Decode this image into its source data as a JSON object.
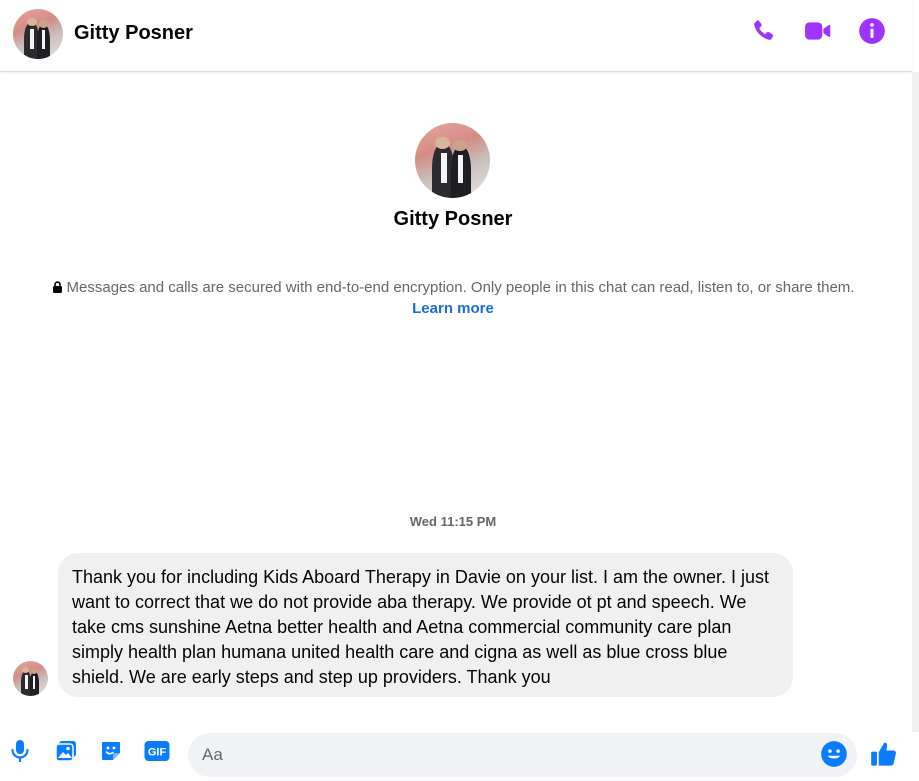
{
  "header": {
    "contact_name": "Gitty Posner",
    "icons": [
      "phone-icon",
      "video-camera-icon",
      "info-icon"
    ]
  },
  "profile": {
    "name": "Gitty Posner"
  },
  "encryption_notice": {
    "text": "Messages and calls are secured with end-to-end encryption. Only people in this chat can read, listen to, or share them.",
    "link": "Learn more"
  },
  "conversation": {
    "timestamp": "Wed 11:15 PM",
    "messages": [
      {
        "sender": "Gitty Posner",
        "text": "Thank you for including Kids Aboard Therapy in Davie on your list. I am the owner. I just want to correct that we do not provide aba therapy. We provide ot pt and speech. We take cms sunshine Aetna better health and Aetna commercial community care plan simply health plan humana united health care and cigna as well as blue cross blue shield. We are early steps and step up providers. Thank you"
      }
    ]
  },
  "composer": {
    "placeholder": "Aa",
    "value": "",
    "icons": [
      "microphone-icon",
      "image-icon",
      "sticker-icon",
      "gif-icon",
      "emoji-icon",
      "thumbs-up-icon"
    ]
  },
  "colors": {
    "accent_purple": "#a033ff",
    "accent_blue": "#0a7cff",
    "link_blue": "#1a6ed8",
    "bubble_gray": "#f0f0f0",
    "secondary_text": "#65676b"
  }
}
